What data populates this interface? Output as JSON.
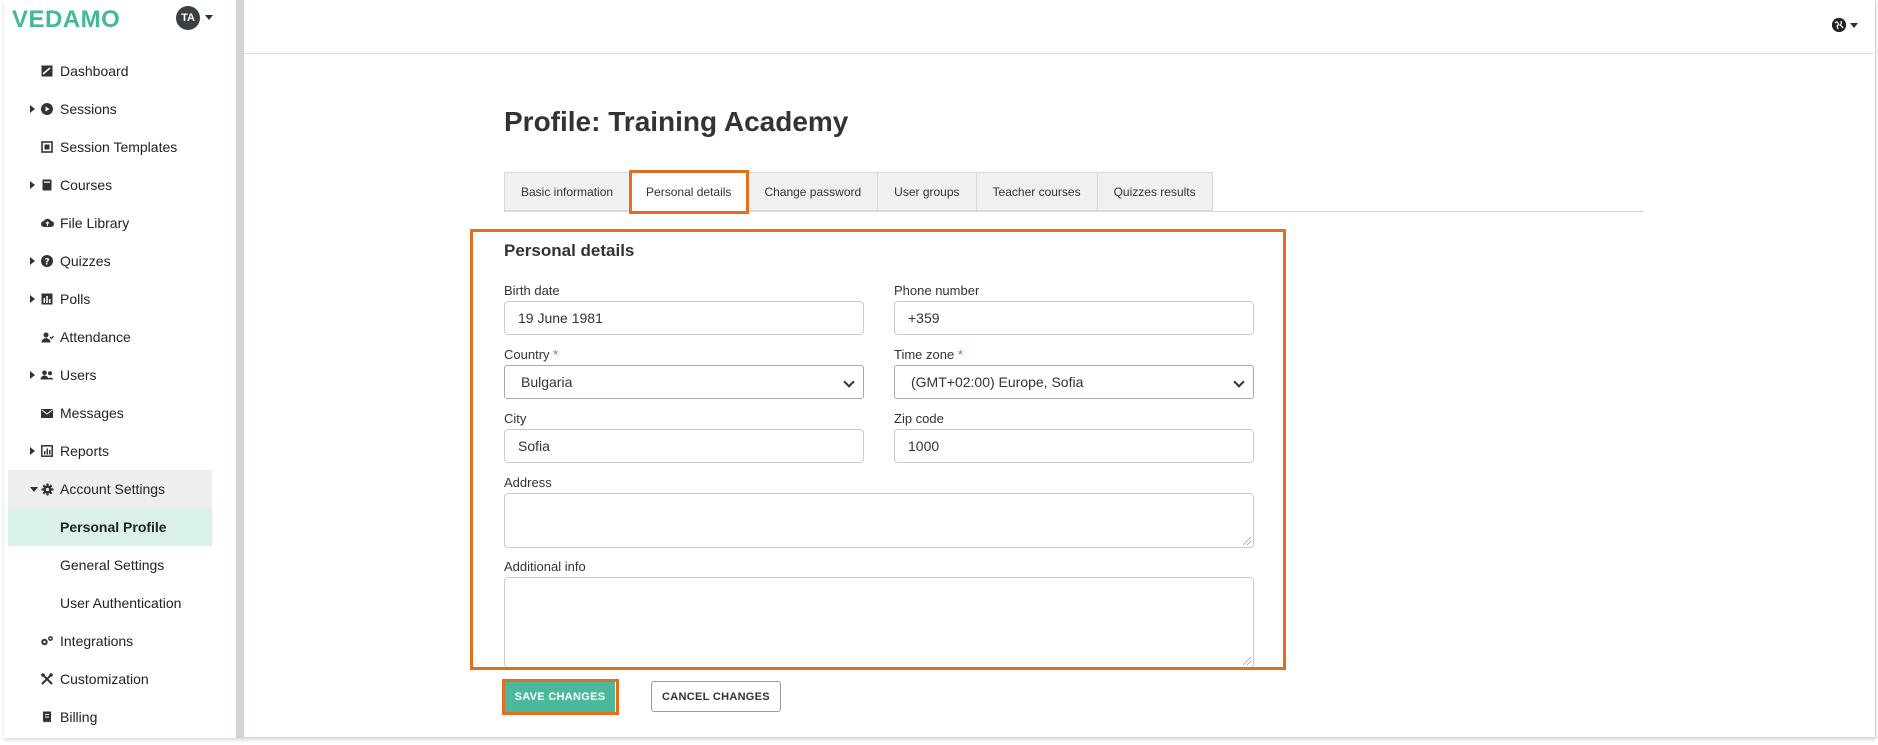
{
  "app": {
    "logo": "VEDAMO",
    "avatar_initials": "TA",
    "brand_color": "#43b89a",
    "highlight_color": "#e36f1e"
  },
  "sidebar": {
    "items": [
      {
        "label": "Dashboard",
        "icon": "dashboard-icon"
      },
      {
        "label": "Sessions",
        "icon": "play-circle-icon",
        "expandable": true
      },
      {
        "label": "Session Templates",
        "icon": "template-icon"
      },
      {
        "label": "Courses",
        "icon": "book-icon",
        "expandable": true
      },
      {
        "label": "File Library",
        "icon": "cloud-icon"
      },
      {
        "label": "Quizzes",
        "icon": "question-icon",
        "expandable": true
      },
      {
        "label": "Polls",
        "icon": "bar-chart-icon",
        "expandable": true
      },
      {
        "label": "Attendance",
        "icon": "person-check-icon"
      },
      {
        "label": "Users",
        "icon": "users-icon",
        "expandable": true
      },
      {
        "label": "Messages",
        "icon": "envelope-icon"
      },
      {
        "label": "Reports",
        "icon": "report-icon",
        "expandable": true
      },
      {
        "label": "Account Settings",
        "icon": "gear-icon",
        "expanded": true
      },
      {
        "label": "Personal Profile",
        "sub": true,
        "current": true
      },
      {
        "label": "General Settings",
        "sub": true
      },
      {
        "label": "User Authentication",
        "sub": true
      },
      {
        "label": "Integrations",
        "icon": "cogs-icon"
      },
      {
        "label": "Customization",
        "icon": "tools-icon"
      },
      {
        "label": "Billing",
        "icon": "receipt-icon"
      }
    ]
  },
  "main": {
    "title": "Profile: Training Academy",
    "tabs": [
      {
        "label": "Basic information"
      },
      {
        "label": "Personal details",
        "active": true
      },
      {
        "label": "Change password"
      },
      {
        "label": "User groups"
      },
      {
        "label": "Teacher courses"
      },
      {
        "label": "Quizzes results"
      }
    ],
    "section_title": "Personal details",
    "fields": {
      "birth_date": {
        "label": "Birth date",
        "value": "19 June 1981"
      },
      "phone": {
        "label": "Phone number",
        "value": "+359"
      },
      "country": {
        "label": "Country",
        "required_mark": "*",
        "value": "Bulgaria"
      },
      "timezone": {
        "label": "Time zone",
        "required_mark": "*",
        "value": "(GMT+02:00) Europe, Sofia"
      },
      "city": {
        "label": "City",
        "value": "Sofia"
      },
      "zip": {
        "label": "Zip code",
        "value": "1000"
      },
      "address": {
        "label": "Address",
        "value": ""
      },
      "additional_info": {
        "label": "Additional info",
        "value": ""
      }
    },
    "save_label": "SAVE CHANGES",
    "cancel_label": "CANCEL CHANGES"
  }
}
